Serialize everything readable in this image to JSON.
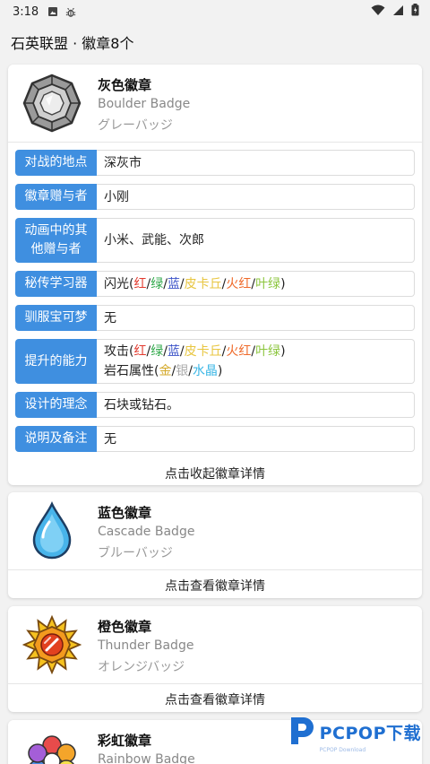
{
  "status": {
    "time": "3:18"
  },
  "app": {
    "title": "石英联盟 · 徽章8个"
  },
  "badges": [
    {
      "name_zh": "灰色徽章",
      "name_en": "Boulder Badge",
      "name_jp": "グレーバッジ",
      "icon": "boulder-badge-icon",
      "expanded": true,
      "details": [
        {
          "label": "对战的地点",
          "value": "深灰市"
        },
        {
          "label": "徽章赠与者",
          "value": "小刚"
        },
        {
          "label": "动画中的其他赠与者",
          "value": "小米、武能、次郎"
        },
        {
          "label": "秘传学习器",
          "value": "闪光(红/绿/蓝/皮卡丘/火红/叶绿)"
        },
        {
          "label": "驯服宝可梦",
          "value": "无"
        },
        {
          "label": "提升的能力",
          "value": "攻击(红/绿/蓝/皮卡丘/火红/叶绿)\n岩石属性(金/银/水晶)"
        },
        {
          "label": "设计的理念",
          "value": "石块或钻石。"
        },
        {
          "label": "说明及备注",
          "value": "无"
        }
      ],
      "button": "点击收起徽章详情"
    },
    {
      "name_zh": "蓝色徽章",
      "name_en": "Cascade Badge",
      "name_jp": "ブルーバッジ",
      "icon": "cascade-badge-icon",
      "expanded": false,
      "button": "点击查看徽章详情"
    },
    {
      "name_zh": "橙色徽章",
      "name_en": "Thunder Badge",
      "name_jp": "オレンジバッジ",
      "icon": "thunder-badge-icon",
      "expanded": false,
      "button": "点击查看徽章详情"
    },
    {
      "name_zh": "彩虹徽章",
      "name_en": "Rainbow Badge",
      "icon": "rainbow-badge-icon",
      "expanded": false
    }
  ],
  "tokens": {
    "hm_open": "闪光(",
    "atk_open": "攻击(",
    "rock_open": "岩石属性(",
    "close": ")",
    "sep": "/",
    "red": "红",
    "green": "绿",
    "blue": "蓝",
    "pikachu": "皮卡丘",
    "firered": "火红",
    "leafgreen": "叶绿",
    "gold": "金",
    "silver": "银",
    "crystal": "水晶"
  },
  "colors": {
    "label_bg": "#3f8fe0",
    "red": "#e23a2e",
    "green": "#2fa84a",
    "blue": "#3a52c8",
    "pikachu": "#e8c640",
    "firered": "#ef6a2a",
    "leafgreen": "#8cc63e",
    "gold": "#d4a92a",
    "silver": "#aaaaaa",
    "crystal": "#3cb7e6"
  },
  "watermark": {
    "text": "PCPOP下载",
    "sub": "PCPOP Download"
  }
}
